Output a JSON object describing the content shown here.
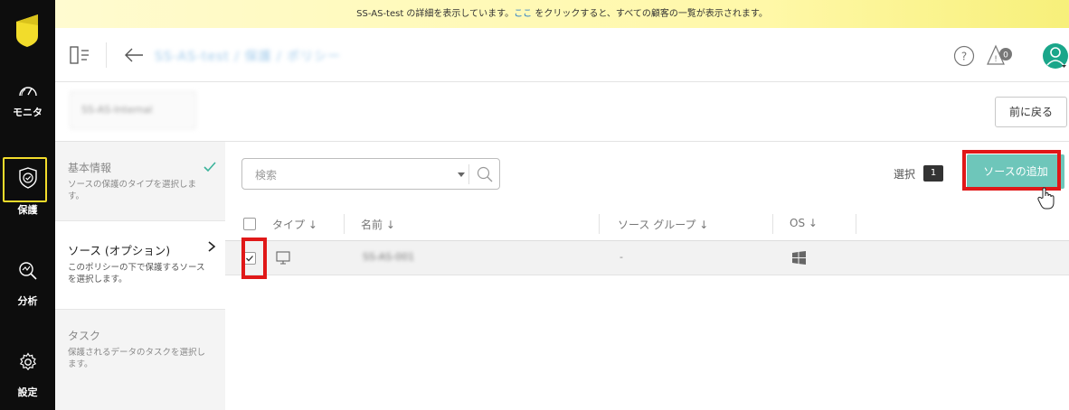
{
  "rail": {
    "items": [
      {
        "label": "モニタ",
        "icon": "gauge-icon"
      },
      {
        "label": "保護",
        "icon": "shield-check-icon",
        "active": true
      },
      {
        "label": "分析",
        "icon": "analytics-icon"
      },
      {
        "label": "設定",
        "icon": "gear-icon"
      }
    ],
    "accent": "#f2dc2b"
  },
  "banner": {
    "prefix": "SS-AS-test の詳細を表示しています。",
    "link": "ここ",
    "suffix": " をクリックすると、すべての顧客の一覧が表示されます。"
  },
  "header": {
    "breadcrumb": "SS-AS-test  /  保護  /  ポリシー",
    "help_icon": "help-icon",
    "alert_count": "0"
  },
  "subheader": {
    "env_name": "SS-AS-Internal",
    "back_button": "前に戻る"
  },
  "steps": [
    {
      "title": "基本情報",
      "desc": "ソースの保護のタイプを選択します。",
      "done": true
    },
    {
      "title": "ソース (オプション)",
      "desc": "このポリシーの下で保護するソースを選択します。",
      "current": true
    },
    {
      "title": "タスク",
      "desc": "保護されるデータのタスクを選択します。"
    }
  ],
  "toolbar": {
    "search_placeholder": "検索",
    "selected_label": "選択",
    "selected_count": "1",
    "add_button": "ソースの追加",
    "add_button_color": "#6ec6ba"
  },
  "table": {
    "columns": [
      "タイプ ↓",
      "名前 ↓",
      "ソース グループ ↓",
      "OS ↓"
    ],
    "rows": [
      {
        "checked": true,
        "type_icon": "monitor-icon",
        "name": "SS-AS-001",
        "group": "-",
        "os_icon": "windows-icon"
      }
    ]
  },
  "highlight_color": "#e01818"
}
